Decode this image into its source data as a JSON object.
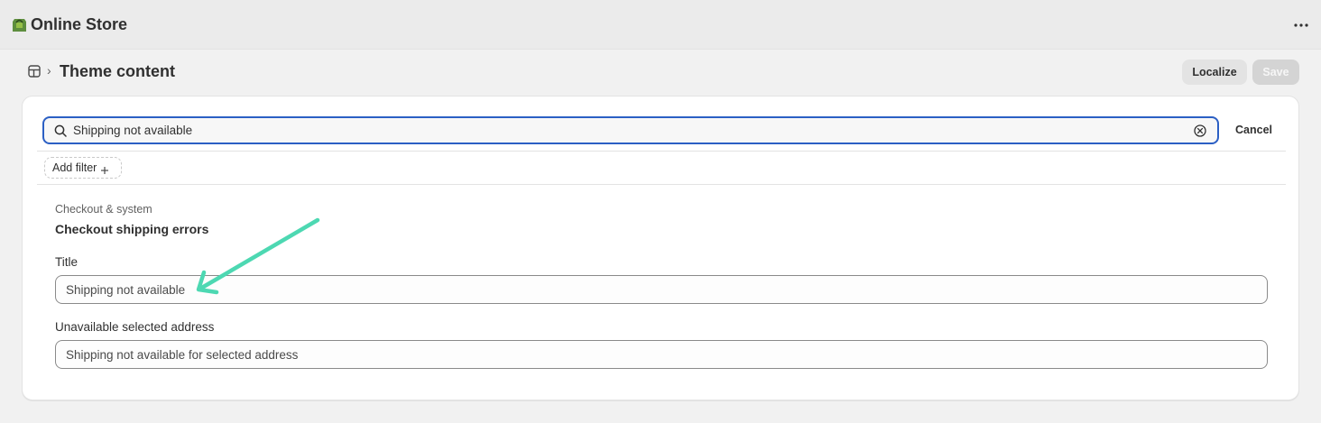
{
  "app": {
    "title": "Online Store",
    "logo_icon": "shopify-bag-icon",
    "menu_icon": "more-horizontal-icon"
  },
  "header": {
    "breadcrumb_icon": "store-icon",
    "breadcrumb_separator": "›",
    "title": "Theme content",
    "localize_label": "Localize",
    "save_label": "Save"
  },
  "search": {
    "value": "Shipping not available",
    "cancel_label": "Cancel"
  },
  "filter": {
    "add_label": "Add filter"
  },
  "section": {
    "eyebrow": "Checkout & system",
    "title": "Checkout shipping errors",
    "fields": [
      {
        "label": "Title",
        "value": "Shipping not available"
      },
      {
        "label": "Unavailable selected address",
        "value": "Shipping not available for selected address"
      }
    ]
  },
  "colors": {
    "accent": "#2b5fc4",
    "annotation_arrow": "#4dd8b2",
    "logo_green": "#5e8e3e"
  }
}
